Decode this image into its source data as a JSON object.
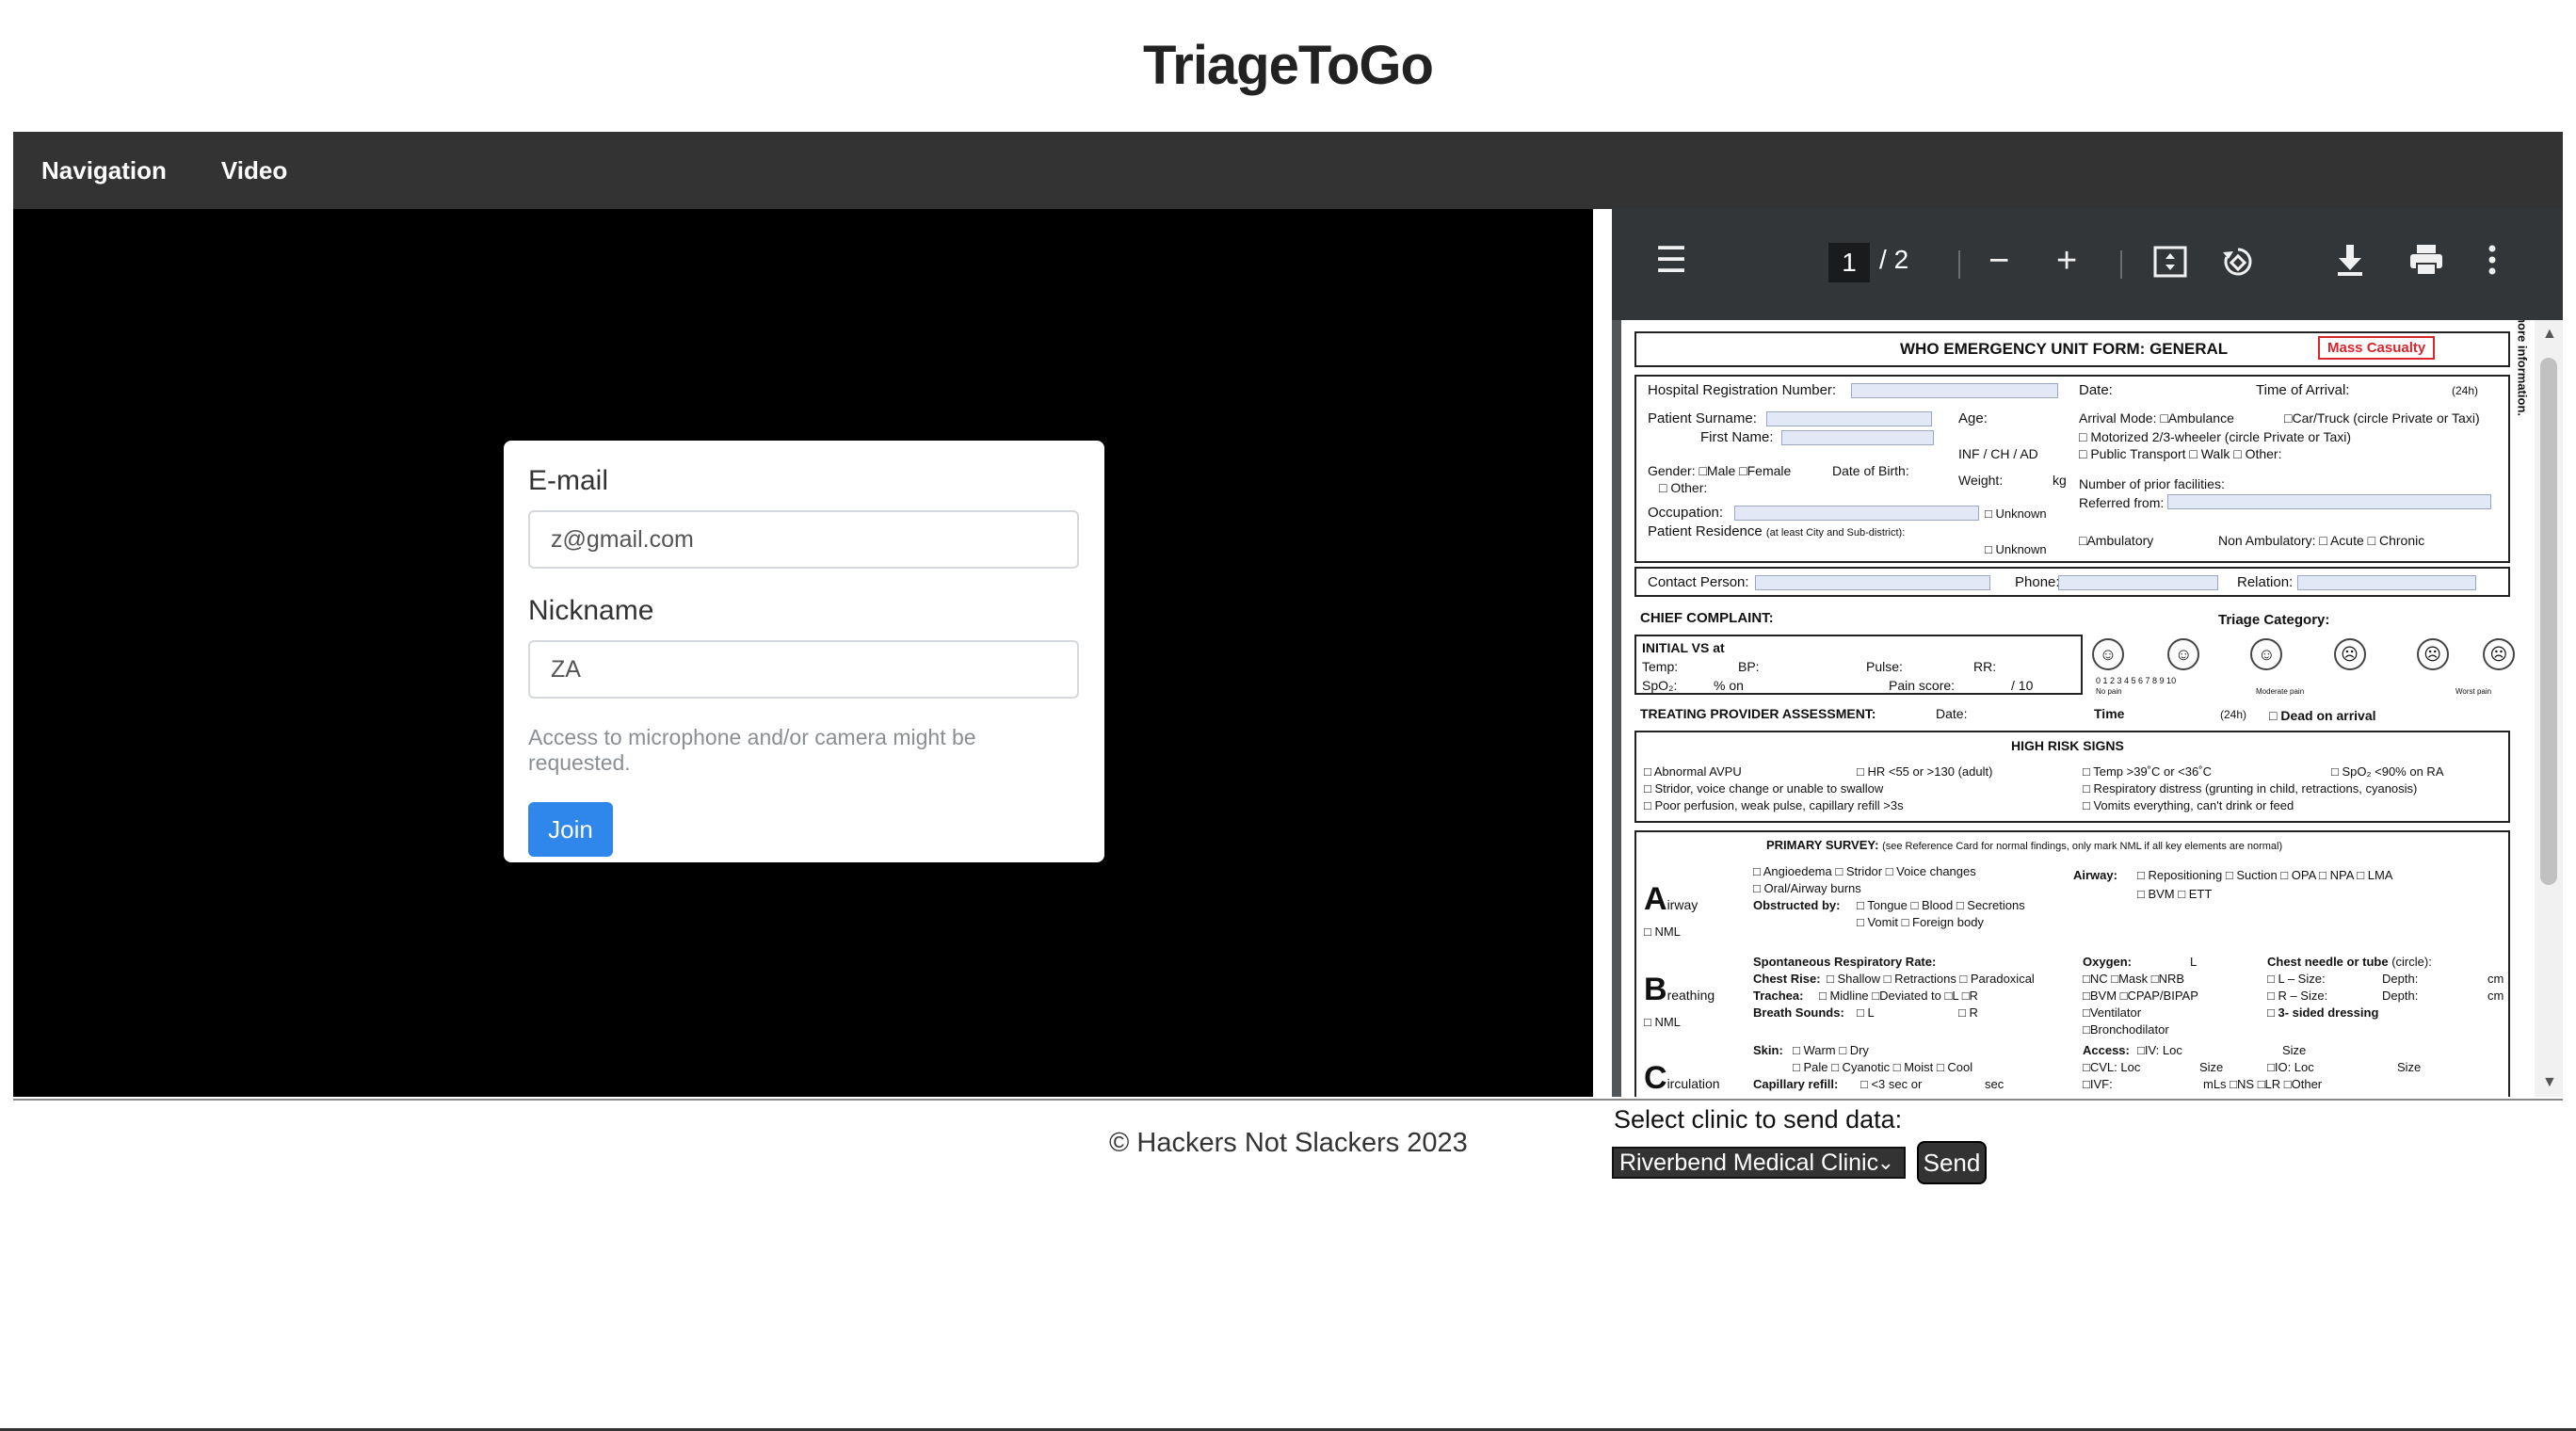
{
  "app": {
    "title": "TriageToGo"
  },
  "navbar": {
    "items": [
      "Navigation",
      "Video"
    ]
  },
  "join_form": {
    "email_label": "E-mail",
    "email_value": "z@gmail.com",
    "nickname_label": "Nickname",
    "nickname_value": "ZA",
    "hint": "Access to microphone and/or camera might be requested.",
    "join_label": "Join",
    "join_color": "#2f86eb"
  },
  "pdf_viewer": {
    "current_page": "1",
    "total_pages": "2",
    "icons": [
      "menu-icon",
      "zoom-out-icon",
      "zoom-in-icon",
      "fit-page-icon",
      "rotate-icon",
      "download-icon",
      "print-icon",
      "more-icon"
    ],
    "form": {
      "title": "WHO EMERGENCY UNIT FORM: GENERAL",
      "mass_casualty": "Mass Casualty",
      "hospital_reg": "Hospital Registration Number:",
      "date": "Date:",
      "time_of_arrival": "Time of Arrival:",
      "h24": "(24h)",
      "patient_surname": "Patient Surname:",
      "first_name": "First Name:",
      "age": "Age:",
      "inf_ch_ad": "INF  /  CH  /  AD",
      "arrival_mode": "Arrival Mode: □Ambulance",
      "car_truck": "□Car/Truck (circle Private or Taxi)",
      "motorized": "□ Motorized 2/3-wheeler (circle Private or Taxi)",
      "public_transport": "□ Public Transport   □ Walk   □ Other:",
      "gender": "Gender: □Male   □Female",
      "other": "□ Other:",
      "dob": "Date of Birth:",
      "weight": "Weight:",
      "kg": "kg",
      "prior_facilities": "Number of prior facilities:",
      "referred_from": "Referred from:",
      "occupation": "Occupation:",
      "unknown": "□ Unknown",
      "residence": "Patient Residence",
      "residence_note": "(at least City and Sub-district):",
      "ambulatory": "□Ambulatory",
      "non_ambulatory": "Non Ambulatory:  □ Acute  □ Chronic",
      "contact_person": "Contact Person:",
      "phone": "Phone:",
      "relation": "Relation:",
      "chief_complaint": "CHIEF COMPLAINT:",
      "triage_category": "Triage Category:",
      "initial_vs": "INITIAL VS at",
      "temp": "Temp:",
      "bp": "BP:",
      "pulse": "Pulse:",
      "rr": "RR:",
      "spo2": "SpO₂:",
      "pct_on": "% on",
      "pain_score": "Pain score:",
      "of_ten": "/ 10",
      "pain_scale": "0     1     2     3     4     5     6     7     8     9     10",
      "no_pain": "No pain",
      "moderate_pain": "Moderate pain",
      "worst_pain": "Worst pain",
      "treating": "TREATING PROVIDER ASSESSMENT:",
      "time": "Time",
      "dead_on_arrival": "□  Dead on arrival",
      "high_risk": "HIGH RISK SIGNS",
      "hr1": "□ Abnormal AVPU",
      "hr2": "□ HR <55 or >130 (adult)",
      "hr3": "□ Temp >39˚C or <36˚C",
      "hr4": "□ SpO₂ <90% on RA",
      "hr5": "□ Stridor, voice change or unable to swallow",
      "hr6": "□ Respiratory distress  (grunting in child, retractions, cyanosis)",
      "hr7": "□ Poor perfusion, weak pulse, capillary refill >3s",
      "hr8": "□ Vomits everything, can't drink or feed",
      "primary_survey": "PRIMARY SURVEY:",
      "primary_note": "(see Reference Card for normal findings, only mark NML if all key elements are normal)",
      "airway_letter": "A",
      "airway_word": "irway",
      "nml": "□ NML",
      "aw1": "□ Angioedema   □ Stridor   □ Voice changes",
      "aw2": "□ Oral/Airway burns",
      "aw3": "Obstructed by:",
      "aw3b": "□ Tongue    □ Blood   □ Secretions",
      "aw4": "□ Vomit     □ Foreign body",
      "airway_int": "Airway:",
      "ai1": "□ Repositioning   □ Suction   □ OPA    □ NPA    □ LMA",
      "ai2": "□ BVM     □ ETT",
      "breathing_letter": "B",
      "breathing_word": "reathing",
      "b1": "Spontaneous Respiratory Rate:",
      "b2": "Chest Rise:",
      "b2b": "□ Shallow  □ Retractions  □ Paradoxical",
      "b3": "Trachea:",
      "b3b": "□ Midline     □Deviated to □L  □R",
      "b4": "Breath Sounds:",
      "b4b": "□ L",
      "b4c": "□ R",
      "oxygen": "Oxygen:",
      "l": "L",
      "ox1": "□NC   □Mask   □NRB",
      "ox2": "□BVM   □CPAP/BIPAP",
      "ox3": "□Ventilator",
      "ox4": "□Bronchodilator",
      "chest_needle": "Chest needle or tube",
      "circle": "(circle):",
      "cn1": "□ L  –  Size:",
      "cn2": "□ R  –  Size:",
      "depth": "Depth:",
      "cm": "cm",
      "cn3": "□ 3- sided dressing",
      "circulation_letter": "C",
      "circulation_word": "irculation",
      "skin": "Skin:",
      "skin1": "□ Warm  □ Dry",
      "skin2": "□ Pale    □ Cyanotic    □ Moist    □ Cool",
      "cap_refill": "Capillary refill:",
      "cap1": "□ <3 sec  or",
      "sec": "sec",
      "access": "Access:",
      "ac1": "□IV: Loc",
      "size": "Size",
      "ac2": "□CVL:  Loc",
      "ac3": "□IO: Loc",
      "ac4": "□IVF:",
      "ac5": "mLs    □NS   □LR   □Other",
      "side_note": "Form to be used with WHO Reference Card. See who.int/emergencycare for more information."
    }
  },
  "footer": {
    "copyright": "© Hackers Not Slackers 2023",
    "select_label": "Select clinic to send data:",
    "selected_clinic": "Riverbend Medical Clinic",
    "send_label": "Send"
  }
}
